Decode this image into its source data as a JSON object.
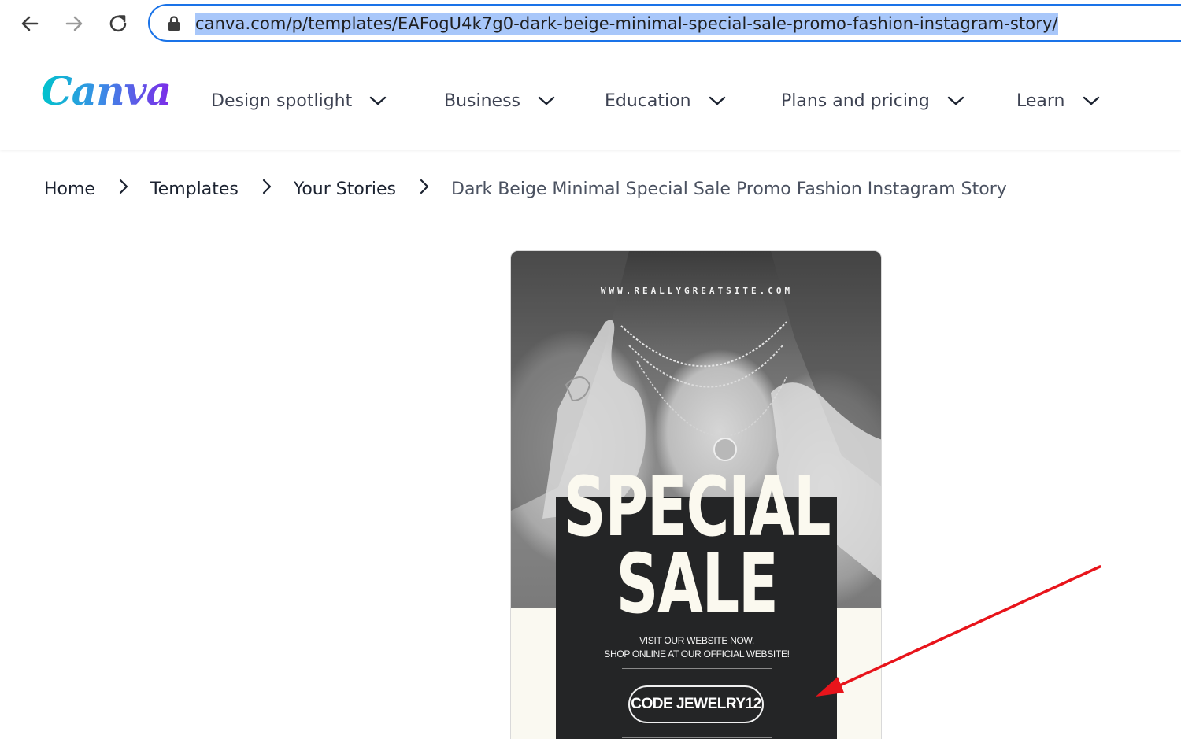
{
  "browser": {
    "url": "canva.com/p/templates/EAFogU4k7g0-dark-beige-minimal-special-sale-promo-fashion-instagram-story/"
  },
  "header": {
    "logo_text": "Canva",
    "nav": [
      {
        "label": "Design spotlight"
      },
      {
        "label": "Business"
      },
      {
        "label": "Education"
      },
      {
        "label": "Plans and pricing"
      },
      {
        "label": "Learn"
      }
    ]
  },
  "breadcrumb": {
    "items": [
      "Home",
      "Templates",
      "Your Stories",
      "Dark Beige Minimal Special Sale Promo Fashion Instagram Story"
    ]
  },
  "template": {
    "website": "WWW.REALLYGREATSITE.COM",
    "headline_1": "SPECIAL",
    "headline_2": "SALE",
    "sub_1": "VISIT OUR WEBSITE NOW.",
    "sub_2": "SHOP ONLINE AT OUR OFFICIAL WEBSITE!",
    "code_label": "CODE JEWELRY12"
  },
  "colors": {
    "url_highlight": "#a8c7fa",
    "focus_ring": "#1a73e8",
    "panel_dark": "#242526",
    "beige": "#faf9f1",
    "annotation_arrow": "#e8141b"
  },
  "icons": [
    "back-arrow-icon",
    "forward-arrow-icon",
    "reload-icon",
    "lock-icon",
    "chevron-down-icon",
    "chevron-right-icon"
  ]
}
